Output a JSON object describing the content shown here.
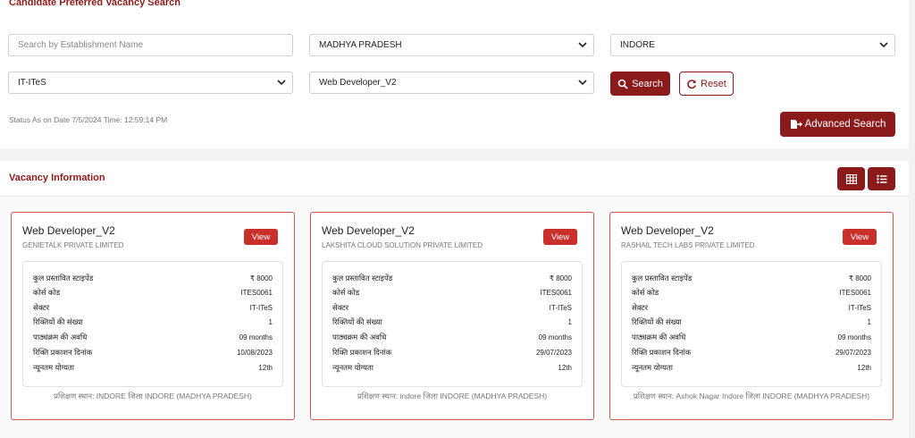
{
  "search": {
    "title": "Candidate Preferred Vacancy Search",
    "establishment_placeholder": "Search by Establishment Name",
    "state": "MADHYA PRADESH",
    "district": "INDORE",
    "sector": "IT-ITeS",
    "course": "Web Developer_V2",
    "search_label": "Search",
    "reset_label": "Reset",
    "status_text": "Status As on Date 7/5/2024 Time: 12:59:14 PM",
    "advanced_label": "Advanced Search"
  },
  "vacancy": {
    "title": "Vacancy Information",
    "view_label": "View",
    "field_labels": [
      "कुल प्रस्तावित स्टाइपेंड",
      "कोर्स कोड",
      "सेक्टर",
      "रिक्तियों की संख्या",
      "पाठ्यक्रम की अवधि",
      "रिक्ति प्रकाशन दिनांक",
      "न्यूनतम योग्यता"
    ],
    "cards": [
      {
        "title": "Web Developer_V2",
        "company": "GENIETALK PRIVATE LIMITED",
        "values": [
          "₹ 8000",
          "ITES0061",
          "IT-ITeS",
          "1",
          "09 months",
          "10/08/2023",
          "12th"
        ],
        "location": "प्रशिक्षण स्थान: INDORE जिला INDORE (MADHYA PRADESH)"
      },
      {
        "title": "Web Developer_V2",
        "company": "LAKSHITA CLOUD SOLUTION PRIVATE LIMITED",
        "values": [
          "₹ 8000",
          "ITES0061",
          "IT-ITeS",
          "1",
          "09 months",
          "29/07/2023",
          "12th"
        ],
        "location": "प्रशिक्षण स्थान: indore जिला INDORE (MADHYA PRADESH)"
      },
      {
        "title": "Web Developer_V2",
        "company": "RASHAIL TECH LABS PRIVATE LIMITED",
        "values": [
          "₹ 8000",
          "ITES0061",
          "IT-ITeS",
          "1",
          "09 months",
          "29/07/2023",
          "12th"
        ],
        "location": "प्रशिक्षण स्थान: Ashok Nagar Indore जिला INDORE (MADHYA PRADESH)"
      }
    ]
  },
  "icons": {
    "search": "search-icon",
    "reset": "refresh-icon",
    "advanced": "advanced-search-icon",
    "grid": "grid-view-icon",
    "list": "list-view-icon",
    "dropdown": "chevron-down-icon"
  },
  "colors": {
    "brand": "#8b1a1a",
    "view_button": "#c9302c",
    "card_border": "#d9534f"
  }
}
